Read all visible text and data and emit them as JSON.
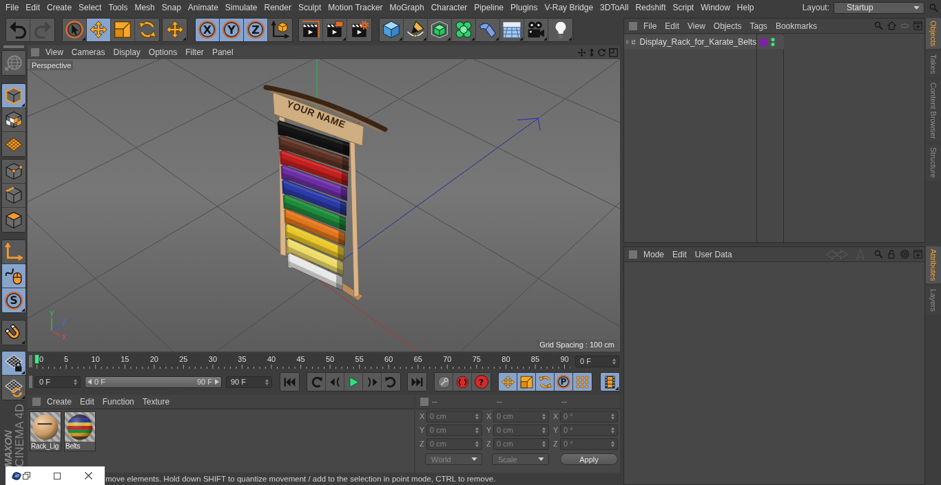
{
  "menu_bar": {
    "items": [
      "File",
      "Edit",
      "Create",
      "Select",
      "Tools",
      "Mesh",
      "Snap",
      "Animate",
      "Simulate",
      "Render",
      "Sculpt",
      "Motion Tracker",
      "MoGraph",
      "Character",
      "Pipeline",
      "Plugins",
      "V-Ray Bridge",
      "3DToAll",
      "Redshift",
      "Script",
      "Window",
      "Help"
    ],
    "layout_label": "Layout:",
    "layout_value": "Startup"
  },
  "toolbar": {
    "groups": [
      [
        {
          "selected": false,
          "disabled": false
        },
        {
          "selected": false,
          "disabled": true
        }
      ],
      [
        {
          "selected": false,
          "disabled": false
        },
        {
          "selected": true,
          "disabled": false
        },
        {
          "selected": false,
          "disabled": false
        },
        {
          "selected": false,
          "disabled": false
        }
      ],
      [
        {
          "selected": false,
          "disabled": false
        }
      ],
      [
        {
          "label": "X",
          "selected": true,
          "disabled": false
        },
        {
          "label": "Y",
          "selected": true,
          "disabled": false
        },
        {
          "label": "Z",
          "selected": true,
          "disabled": false
        },
        {
          "selected": false,
          "disabled": false
        }
      ],
      [
        {
          "selected": false,
          "disabled": false
        },
        {
          "selected": false,
          "disabled": false
        },
        {
          "selected": false,
          "disabled": false
        }
      ],
      [
        {
          "selected": false,
          "disabled": false
        },
        {
          "selected": false,
          "disabled": false
        },
        {
          "selected": false,
          "disabled": false
        },
        {
          "selected": false,
          "disabled": false
        },
        {
          "selected": false,
          "disabled": false
        },
        {
          "selected": false,
          "disabled": false
        },
        {
          "selected": false,
          "disabled": false
        },
        {
          "selected": false,
          "disabled": false
        }
      ]
    ]
  },
  "left_toolbar": {
    "groups": [
      [
        {
          "selected": false
        }
      ],
      [
        {
          "selected": true
        },
        {
          "selected": false
        },
        {
          "selected": false
        }
      ],
      [
        {
          "selected": false
        },
        {
          "selected": false
        },
        {
          "selected": false
        }
      ],
      [
        {
          "selected": false
        },
        {
          "selected": true
        },
        {
          "label": "S",
          "selected": true
        }
      ],
      [
        {
          "selected": false
        }
      ],
      [
        {
          "selected": true
        },
        {
          "selected": false
        }
      ]
    ]
  },
  "logo": {
    "lines": [
      "MAXON",
      "CINEMA 4D"
    ]
  },
  "viewport": {
    "menu": [
      "View",
      "Cameras",
      "Display",
      "Options",
      "Filter",
      "Panel"
    ],
    "camera_label": "Perspective",
    "grid_spacing": "Grid Spacing : 100 cm",
    "axis_labels": [
      "Y",
      "Z",
      "X"
    ],
    "model": {
      "sign_text": "YOUR NAME",
      "belts": [
        {
          "color": "#151515"
        },
        {
          "color": "#5c3324"
        },
        {
          "color": "#c21f1f"
        },
        {
          "color": "#6b2fa3"
        },
        {
          "color": "#2b3aa6"
        },
        {
          "color": "#1e8a3b"
        },
        {
          "color": "#e2761c"
        },
        {
          "color": "#e9c62a"
        },
        {
          "color": "#eddc6a"
        },
        {
          "color": "#e8e8e8"
        }
      ]
    }
  },
  "timeline": {
    "ticks": [
      "0",
      "5",
      "10",
      "15",
      "20",
      "25",
      "30",
      "35",
      "40",
      "45",
      "50",
      "55",
      "60",
      "65",
      "70",
      "75",
      "80",
      "85",
      "90"
    ],
    "playhead": {
      "level": 0
    },
    "current_frame": "0 F"
  },
  "transport": {
    "start_frame": "0 F",
    "range": {
      "start": "0 F",
      "end": "90 F",
      "level": 1
    },
    "end_frame": "90 F",
    "groups": [
      [
        {
          "selected": false
        }
      ],
      [
        {
          "selected": false
        },
        {
          "selected": false
        },
        {
          "selected": false
        },
        {
          "selected": false
        },
        {
          "selected": false
        }
      ],
      [
        {
          "selected": false
        }
      ],
      [
        {
          "selected": false
        },
        {
          "selected": false
        },
        {
          "label": "?",
          "selected": false
        }
      ],
      [
        {
          "selected": true
        },
        {
          "selected": true
        },
        {
          "selected": true
        },
        {
          "label": "P",
          "selected": true
        },
        {
          "selected": true
        }
      ],
      [
        {
          "selected": true
        }
      ]
    ]
  },
  "materials": {
    "menu": [
      "Create",
      "Edit",
      "Function",
      "Texture"
    ],
    "items": [
      {
        "name": "Rack_Lig"
      },
      {
        "name": "Belts"
      }
    ]
  },
  "coordinates": {
    "disabled": true,
    "headers": [
      "--",
      "--",
      "--"
    ],
    "rows": [
      [
        {
          "axis": "X",
          "value": "0 cm"
        },
        {
          "axis": "X",
          "value": "0 cm"
        },
        {
          "axis": "X",
          "value": "0 °"
        }
      ],
      [
        {
          "axis": "Y",
          "value": "0 cm"
        },
        {
          "axis": "Y",
          "value": "0 cm"
        },
        {
          "axis": "Y",
          "value": "0 °"
        }
      ],
      [
        {
          "axis": "Z",
          "value": "0 cm"
        },
        {
          "axis": "Z",
          "value": "0 cm"
        },
        {
          "axis": "Z",
          "value": "0 °"
        }
      ]
    ],
    "dropdowns": [
      "World",
      "Scale"
    ],
    "apply": "Apply"
  },
  "status_bar": {
    "text": "move elements. Hold down SHIFT to quantize movement / add to the selection in point mode, CTRL to remove."
  },
  "objects_manager": {
    "menu": [
      "File",
      "Edit",
      "View",
      "Objects",
      "Tags",
      "Bookmarks"
    ],
    "objects": [
      {
        "name": "Display_Rack_for_Karate_Belts",
        "expanded": false,
        "selected": false,
        "color": "#7b22a6"
      }
    ]
  },
  "attributes_manager": {
    "menu": [
      "Mode",
      "Edit",
      "User Data"
    ]
  },
  "side_tabs": {
    "upper": [
      {
        "label": "Objects",
        "selected": true
      },
      {
        "label": "Takes",
        "selected": false
      },
      {
        "label": "Content Browser",
        "selected": false
      },
      {
        "label": "Structure",
        "selected": false
      }
    ],
    "lower": [
      {
        "label": "Attributes",
        "selected": true
      },
      {
        "label": "Layers",
        "selected": false
      }
    ]
  }
}
